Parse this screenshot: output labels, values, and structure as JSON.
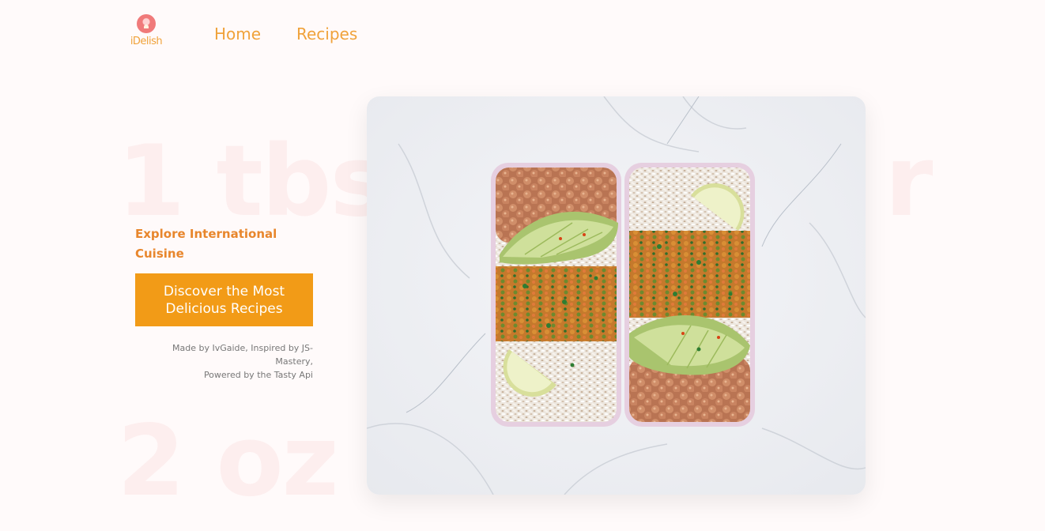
{
  "brand": {
    "name": "iDelish",
    "logo_icon": "donut-icon"
  },
  "nav": {
    "links": [
      {
        "label": "Home"
      },
      {
        "label": "Recipes"
      }
    ]
  },
  "background": {
    "line1": "1 tbs",
    "line1_end": "r",
    "line2": "2 oz"
  },
  "hero": {
    "tagline": "Explore International Cuisine",
    "cta_label": "Discover the Most Delicious Recipes",
    "credits_line1": "Made by IvGaide, Inspired by JS-Mastery,",
    "credits_line2": "Powered by the Tasty Api",
    "image_subject": "meal-prep-containers-photo"
  },
  "colors": {
    "accent": "#f29b17",
    "accent_text": "#f0a23a",
    "tagline": "#e8862c",
    "background": "#fffafa",
    "watermark": "#fdeeee"
  }
}
